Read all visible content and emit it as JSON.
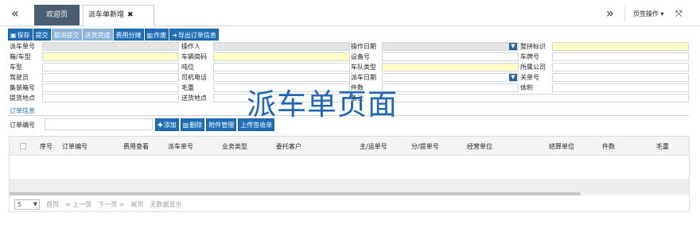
{
  "tabbar": {
    "collapse_glyph": "«",
    "home_tab": "欢迎页",
    "dispatch_tab": "派车单新增",
    "close_glyph": "✖",
    "scroll_glyph": "»",
    "page_ops": "页签操作 ▾",
    "fullscreen_glyph": "⤧"
  },
  "toolbar": {
    "save": "保存",
    "submit": "提交",
    "cancel_submit": "取消提交",
    "delivered": "送货完成",
    "cost_split": "费用分摊",
    "void": "作废",
    "export_order": "导出订单信息"
  },
  "form": {
    "dispatch_no": "派车单号",
    "operator": "操作人",
    "op_date": "操作日期",
    "combined_flag": "整拼标识",
    "box_type": "箱/车型",
    "plate_no": "车辆简码",
    "device_no": "设备号",
    "license_no": "车牌号",
    "vehicle_type": "车型",
    "tonnage": "吨位",
    "fleet_type": "车队类型",
    "company": "所属公司",
    "driver": "驾驶员",
    "driver_phone": "司机电话",
    "dispatch_date": "派车日期",
    "seal_no": "关单号",
    "container_no": "集装箱号",
    "gross_weight": "毛重",
    "pieces": "件数",
    "volume": "体积",
    "pickup_place": "提货地点",
    "delivery_place": "送货地点",
    "remark": "备注"
  },
  "order_section": {
    "title": "订单信息",
    "order_no_label": "订单编号",
    "add": "添加",
    "delete": "删除",
    "attach": "附件管理",
    "upload_receipt": "上传签收单"
  },
  "grid": {
    "columns": [
      "序号",
      "订单编号",
      "费用查看",
      "派车单号",
      "业务类型",
      "委托客户",
      "主/运单号",
      "分/提单号",
      "经营单位",
      "结算单位",
      "件数",
      "毛重"
    ]
  },
  "pager": {
    "page_size": "5",
    "first": "首页",
    "prev": "< 上一页",
    "next": "下一页 >",
    "last": "尾页",
    "empty": "无数据显示"
  },
  "watermark": "派车单页面",
  "colors": {
    "accent": "#1f6fb8",
    "tab_active": "#4a5d72",
    "required_field": "#ffffc6",
    "readonly_field": "#e4e4e4"
  }
}
